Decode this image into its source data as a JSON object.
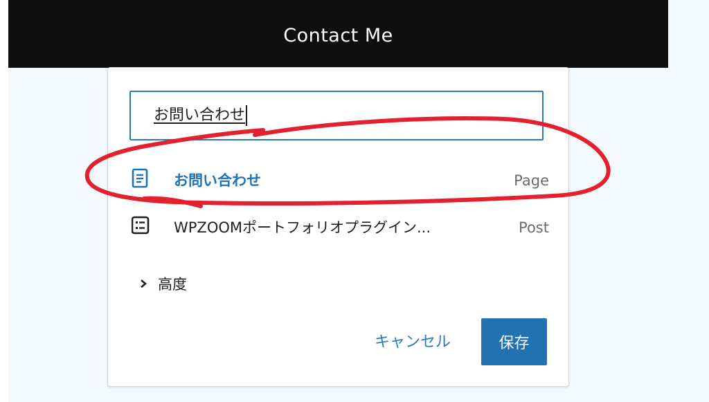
{
  "header": {
    "title": "Contact Me"
  },
  "link_popover": {
    "search_value": "お問い合わせ",
    "results": [
      {
        "title": "お問い合わせ",
        "type": "Page",
        "icon": "page-icon",
        "selected": true
      },
      {
        "title": "WPZOOMポートフォリオプラグイン...",
        "type": "Post",
        "icon": "post-list-icon",
        "selected": false
      }
    ],
    "advanced_label": "高度",
    "cancel_label": "キャンセル",
    "save_label": "保存"
  },
  "colors": {
    "accent": "#2271b1",
    "annotation": "#e3202e",
    "header_bg": "#0f0f0f"
  }
}
